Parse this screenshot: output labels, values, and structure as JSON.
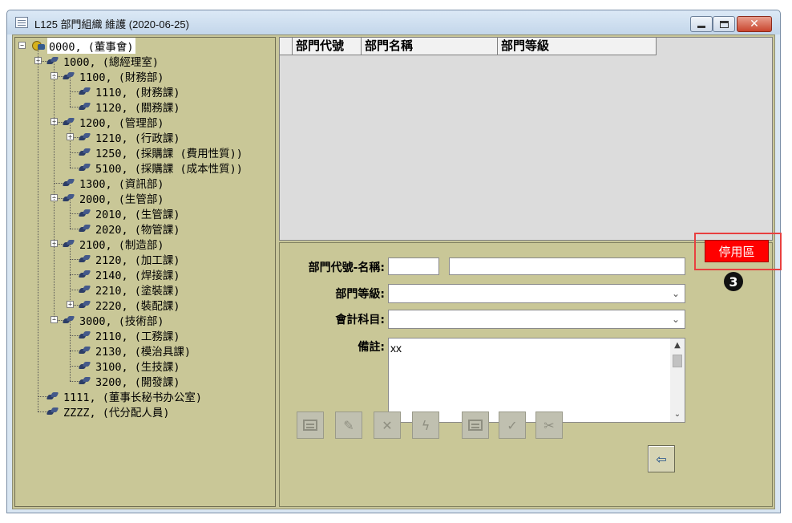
{
  "window": {
    "title": "L125 部門組織 維護 (2020-06-25)",
    "minimize_glyph": "",
    "close_glyph": "✕"
  },
  "tree": {
    "nodes": [
      {
        "label": "0000, (董事會)",
        "selected": true,
        "expander": "−"
      },
      {
        "label": "1000, (總經理室)",
        "expander": "−"
      },
      {
        "label": "1100, (財務部)",
        "expander": "−"
      },
      {
        "label": "1110, (財務課)"
      },
      {
        "label": "1120, (關務課)"
      },
      {
        "label": "1200, (管理部)",
        "expander": "−"
      },
      {
        "label": "1210, (行政課)",
        "expander": "+"
      },
      {
        "label": "1250, (採購課 (費用性質))"
      },
      {
        "label": "5100, (採購課 (成本性質))"
      },
      {
        "label": "1300, (資訊部)"
      },
      {
        "label": "2000, (生管部)",
        "expander": "−"
      },
      {
        "label": "2010, (生管課)"
      },
      {
        "label": "2020, (物管課)"
      },
      {
        "label": "2100, (制造部)",
        "expander": "−"
      },
      {
        "label": "2120, (加工課)"
      },
      {
        "label": "2140, (焊接課)"
      },
      {
        "label": "2210, (塗裝課)"
      },
      {
        "label": "2220, (裝配課)",
        "expander": "+"
      },
      {
        "label": "3000, (技術部)",
        "expander": "−"
      },
      {
        "label": "2110, (工務課)"
      },
      {
        "label": "2130, (模治具課)"
      },
      {
        "label": "3100, (生技課)"
      },
      {
        "label": "3200, (開發課)"
      },
      {
        "label": "1111, (董事长秘书办公室)"
      },
      {
        "label": "ZZZZ, (代分配人員)"
      }
    ]
  },
  "grid": {
    "columns": [
      "部門代號",
      "部門名稱",
      "部門等級"
    ]
  },
  "form": {
    "dept_code_name_label": "部門代號-名稱:",
    "dept_code_value": "",
    "dept_name_value": "",
    "dept_level_label": "部門等級:",
    "dept_level_value": "",
    "account_label": "會計科目:",
    "account_value": "",
    "remarks_label": "備註:",
    "remarks_value": "xx",
    "chevron": "⌄",
    "scroll_up": "▲",
    "scroll_down": "⌄"
  },
  "toolbar": {
    "edit_glyph": "✎",
    "delete_glyph": "✕",
    "lightning_glyph": "ϟ",
    "confirm_glyph": "✓",
    "cut_glyph": "✂",
    "exit_glyph": "⇦"
  },
  "status": {
    "disabled_area_label": "停用區",
    "step_number": "3"
  },
  "colors": {
    "panel_background": "#c9c797",
    "status_red": "#ff0000",
    "highlight_border": "#e84040"
  }
}
